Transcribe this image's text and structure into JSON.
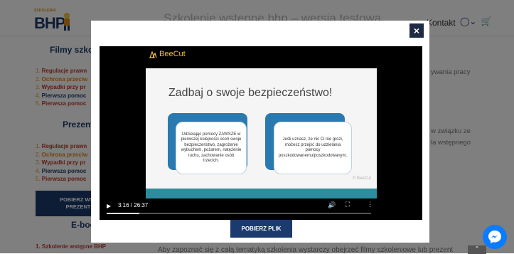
{
  "header": {
    "logo_small": "SZKOLENIA",
    "logo_text": "BHP",
    "title": "Szkolenie wstępne bhp – wersja testowa",
    "contact": "Kontakt",
    "user_icon": "user-icon",
    "cart_icon": "cart-icon"
  },
  "sidebar": {
    "films_heading": "Filmy szkol",
    "films_items": [
      {
        "num": "1.",
        "label": "Regulacje prawn",
        "color": "#c0392b"
      },
      {
        "num": "2.",
        "label": "Ochrona przeciw",
        "color": "#e08a12"
      },
      {
        "num": "3.",
        "label": "Wypadki przy pr",
        "color": "#c0392b"
      },
      {
        "num": "4.",
        "label": "Pierwsza pomoc",
        "color": "#1b3a6d"
      },
      {
        "num": "5.",
        "label": "Pierwsza pomoc",
        "color": "#c0392b"
      }
    ],
    "presentations_heading": "Prezent",
    "presentations_items": [
      {
        "num": "1.",
        "label": "Regulacje prawn",
        "color": "#c0392b"
      },
      {
        "num": "2.",
        "label": "Ochrona przeciw",
        "color": "#e08a12"
      },
      {
        "num": "3.",
        "label": "Wypadki przy pr",
        "color": "#c0392b"
      },
      {
        "num": "4.",
        "label": "Pierwsza pomoc",
        "color": "#1b3a6d"
      },
      {
        "num": "5.",
        "label": "Pierwsza pomoc",
        "color": "#c0392b"
      }
    ],
    "download_btn_line1": "POBIERZ WSZ",
    "download_btn_line2": "PREZENT",
    "ebook_heading": "E-boo",
    "ebook_item": "1. Szkolenie wstępne BHP"
  },
  "main": {
    "right_text_1": "ywania pracy",
    "right_text_2": "w związku ze",
    "right_text_3": "la wstępnego",
    "bottom_text": "Aby zapoznać się z całą tematyką szkolenia wystarczy obejrzeć filmy szkoleniowe lub prezent"
  },
  "modal": {
    "close_label": "×",
    "video": {
      "brand": "BeeCut",
      "slide_title": "Zadbaj o swoje bezpieczeństwo!",
      "card_left_text": "Udzielając pomocy ZAWSZE w pierwszej kolejności oceń swoje bezpieczeństwo, zagrożenie wybuchem, pożarem, natężenie ruchu, zachowanie osób trzecich.",
      "card_right_text": "Jeśli uznasz, że nic Ci nie grozi, możesz przejść do udzielania pomocy poszkodowanemu/poszkodowanym.",
      "watermark": "© BeeCut",
      "time": "3:16 / 26:37",
      "progress": 0.1227
    },
    "download_label": "POBIERZ PLIK"
  }
}
